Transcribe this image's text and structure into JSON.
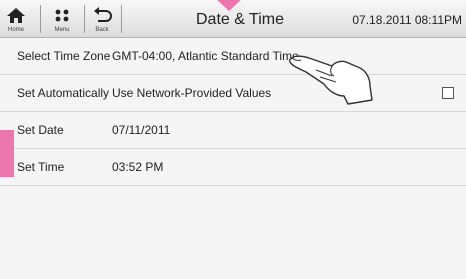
{
  "toolbar": {
    "home_label": "Home",
    "menu_label": "Menu",
    "back_label": "Back",
    "title": "Date & Time",
    "datetime": "07.18.2011 08:11PM"
  },
  "settings": [
    {
      "label": "Select Time Zone",
      "value": "GMT-04:00, Atlantic Standard Time"
    },
    {
      "label": "Set Automatically",
      "value": "Use Network-Provided Values",
      "checked": false
    },
    {
      "label": "Set Date",
      "value": "07/11/2011"
    },
    {
      "label": "Set Time",
      "value": "03:52 PM"
    }
  ],
  "colors": {
    "highlight": "#ec77ac"
  }
}
